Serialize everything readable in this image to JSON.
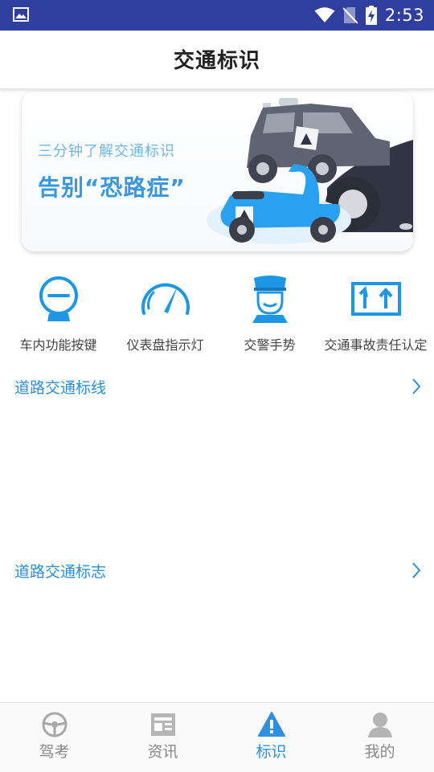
{
  "status_bar": {
    "time": "2:53",
    "icons": [
      "image-icon",
      "wifi-icon",
      "no-sim-icon",
      "battery-charging-icon"
    ]
  },
  "header": {
    "title": "交通标识"
  },
  "banner": {
    "subtitle": "三分钟了解交通标识",
    "headline": "告别“恐路症”"
  },
  "categories": [
    {
      "label": "车内功能按键",
      "icon": "steering-wheel-icon"
    },
    {
      "label": "仪表盘指示灯",
      "icon": "speedometer-icon"
    },
    {
      "label": "交警手势",
      "icon": "traffic-police-icon"
    },
    {
      "label": "交通事故责任认定",
      "icon": "road-arrows-icon"
    }
  ],
  "sections": [
    {
      "label": "道路交通标线"
    },
    {
      "label": "道路交通标志"
    }
  ],
  "bottom_nav": {
    "active": "标识",
    "items": [
      {
        "label": "驾考",
        "icon": "steering-wheel-icon"
      },
      {
        "label": "资讯",
        "icon": "news-icon"
      },
      {
        "label": "标识",
        "icon": "warning-sign-icon"
      },
      {
        "label": "我的",
        "icon": "user-icon"
      }
    ]
  },
  "colors": {
    "status_bar": "#303f9f",
    "accent": "#2f8fe0",
    "nav_inactive": "#888888"
  }
}
